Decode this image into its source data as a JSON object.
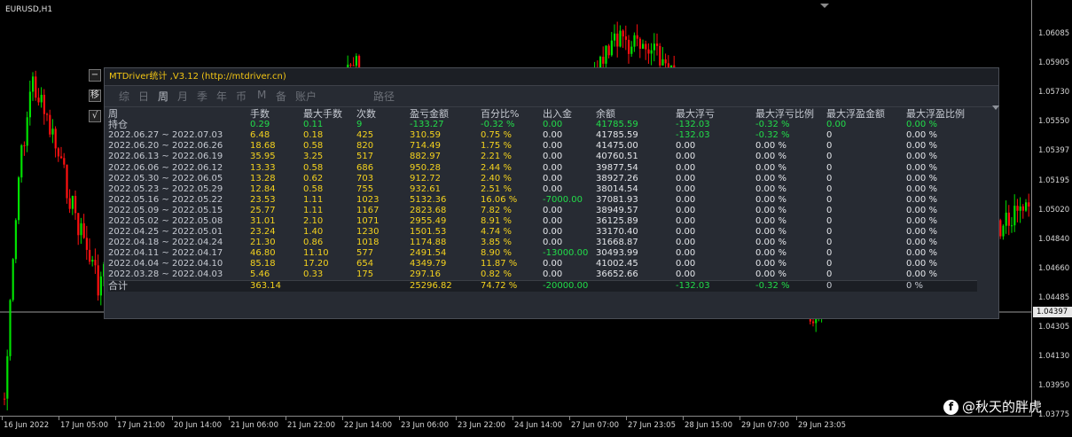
{
  "chart": {
    "symbol": "EURUSD,H1",
    "current_price": "1.04397",
    "price_labels": [
      "1.06085",
      "1.05905",
      "1.05730",
      "1.05550",
      "1.05397",
      "1.05195",
      "1.05020",
      "1.04840",
      "1.04660",
      "1.04485",
      "1.04305",
      "1.04130",
      "1.03950",
      "1.03775"
    ],
    "time_labels": [
      "16 Jun 2022",
      "17 Jun 05:00",
      "17 Jun 21:00",
      "20 Jun 14:00",
      "21 Jun 06:00",
      "21 Jun 22:00",
      "22 Jun 14:00",
      "23 Jun 06:00",
      "23 Jun 22:00",
      "24 Jun 14:00",
      "27 Jun 07:00",
      "27 Jun 23:05",
      "28 Jun 15:00",
      "29 Jun 07:00",
      "29 Jun 23:05"
    ],
    "colors": {
      "bull": "#00e000",
      "bear": "#ff1010",
      "background": "#000000"
    }
  },
  "side_buttons": {
    "minimize": "−",
    "move": "移",
    "check": "√"
  },
  "panel": {
    "title": "MTDriver统计 ,V3.12 (http://mtdriver.cn)",
    "tabs": [
      "综",
      "日",
      "周",
      "月",
      "季",
      "年",
      "币",
      "M",
      "备",
      "账户",
      "路径"
    ],
    "active_tab": "周",
    "columns": [
      "周",
      "手数",
      "最大手数",
      "次数",
      "盈亏金额",
      "百分比%",
      "出入金",
      "余额",
      "最大浮亏",
      "最大浮亏比例",
      "最大浮盈金额",
      "最大浮盈比例"
    ],
    "position_row": [
      "持仓",
      "0.29",
      "0.11",
      "9",
      "-133.27",
      "-0.32 %",
      "0.00",
      "41785.59",
      "-132.03",
      "-0.32 %",
      "0.00",
      "0.00 %"
    ],
    "rows": [
      [
        "2022.06.27 ~ 2022.07.03",
        "6.48",
        "0.18",
        "425",
        "310.59",
        "0.75 %",
        "0.00",
        "41785.59",
        "-132.03",
        "-0.32 %",
        "0",
        "0.00 %"
      ],
      [
        "2022.06.20 ~ 2022.06.26",
        "18.68",
        "0.58",
        "820",
        "714.49",
        "1.75 %",
        "0.00",
        "41475.00",
        "0.00",
        "0.00 %",
        "0",
        "0.00 %"
      ],
      [
        "2022.06.13 ~ 2022.06.19",
        "35.95",
        "3.25",
        "517",
        "882.97",
        "2.21 %",
        "0.00",
        "40760.51",
        "0.00",
        "0.00 %",
        "0",
        "0.00 %"
      ],
      [
        "2022.06.06 ~ 2022.06.12",
        "13.33",
        "0.58",
        "686",
        "950.28",
        "2.44 %",
        "0.00",
        "39877.54",
        "0.00",
        "0.00 %",
        "0",
        "0.00 %"
      ],
      [
        "2022.05.30 ~ 2022.06.05",
        "13.28",
        "0.62",
        "703",
        "912.72",
        "2.40 %",
        "0.00",
        "38927.26",
        "0.00",
        "0.00 %",
        "0",
        "0.00 %"
      ],
      [
        "2022.05.23 ~ 2022.05.29",
        "12.84",
        "0.58",
        "755",
        "932.61",
        "2.51 %",
        "0.00",
        "38014.54",
        "0.00",
        "0.00 %",
        "0",
        "0.00 %"
      ],
      [
        "2022.05.16 ~ 2022.05.22",
        "23.53",
        "1.11",
        "1023",
        "5132.36",
        "16.06 %",
        "-7000.00",
        "37081.93",
        "0.00",
        "0.00 %",
        "0",
        "0.00 %"
      ],
      [
        "2022.05.09 ~ 2022.05.15",
        "25.77",
        "1.11",
        "1167",
        "2823.68",
        "7.82 %",
        "0.00",
        "38949.57",
        "0.00",
        "0.00 %",
        "0",
        "0.00 %"
      ],
      [
        "2022.05.02 ~ 2022.05.08",
        "31.01",
        "2.10",
        "1071",
        "2955.49",
        "8.91 %",
        "0.00",
        "36125.89",
        "0.00",
        "0.00 %",
        "0",
        "0.00 %"
      ],
      [
        "2022.04.25 ~ 2022.05.01",
        "23.24",
        "1.40",
        "1230",
        "1501.53",
        "4.74 %",
        "0.00",
        "33170.40",
        "0.00",
        "0.00 %",
        "0",
        "0.00 %"
      ],
      [
        "2022.04.18 ~ 2022.04.24",
        "21.30",
        "0.86",
        "1018",
        "1174.88",
        "3.85 %",
        "0.00",
        "31668.87",
        "0.00",
        "0.00 %",
        "0",
        "0.00 %"
      ],
      [
        "2022.04.11 ~ 2022.04.17",
        "46.80",
        "11.10",
        "577",
        "2491.54",
        "8.90 %",
        "-13000.00",
        "30493.99",
        "0.00",
        "0.00 %",
        "0",
        "0.00 %"
      ],
      [
        "2022.04.04 ~ 2022.04.10",
        "85.18",
        "17.20",
        "654",
        "4349.79",
        "11.87 %",
        "0.00",
        "41002.45",
        "0.00",
        "0.00 %",
        "0",
        "0.00 %"
      ],
      [
        "2022.03.28 ~ 2022.04.03",
        "5.46",
        "0.33",
        "175",
        "297.16",
        "0.82 %",
        "0.00",
        "36652.66",
        "0.00",
        "0.00 %",
        "0",
        "0.00 %"
      ]
    ],
    "total_row": [
      "合计",
      "363.14",
      "",
      "",
      "25296.82",
      "74.72 %",
      "-20000.00",
      "",
      "-132.03",
      "-0.32 %",
      "0",
      "0 %"
    ]
  },
  "watermark": {
    "logo": "f",
    "text": "@秋天的胖虎"
  }
}
